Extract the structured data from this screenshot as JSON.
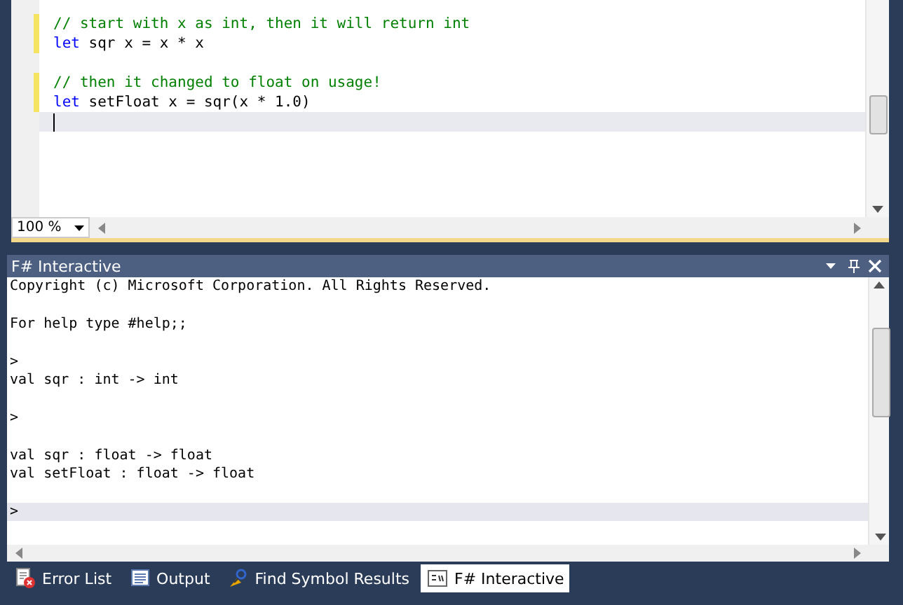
{
  "editor": {
    "lines": [
      {
        "kind": "comment",
        "text": "// start with x as int, then it will return int",
        "changed": true,
        "current": false
      },
      {
        "kind": "code",
        "keyword": "let",
        "text": " sqr x = x * x",
        "changed": true,
        "current": false
      },
      {
        "kind": "blank",
        "changed": false,
        "current": false
      },
      {
        "kind": "comment",
        "text": "// then it changed to float on usage!",
        "changed": true,
        "current": false
      },
      {
        "kind": "code",
        "keyword": "let",
        "text": " setFloat x = sqr(x * 1.0)",
        "changed": true,
        "current": false
      },
      {
        "kind": "blank",
        "changed": false,
        "current": true
      }
    ],
    "zoom": "100 %"
  },
  "interactive": {
    "title": "F# Interactive",
    "lines": [
      {
        "text": "Copyright (c) Microsoft Corporation. All Rights Reserved.",
        "current": false
      },
      {
        "current": false
      },
      {
        "text": "For help type #help;;",
        "current": false
      },
      {
        "current": false
      },
      {
        "text": ">",
        "current": false
      },
      {
        "text": "val sqr : int -> int",
        "current": false
      },
      {
        "current": false
      },
      {
        "text": ">",
        "current": false
      },
      {
        "current": false
      },
      {
        "text": "val sqr : float -> float",
        "current": false
      },
      {
        "text": "val setFloat : float -> float",
        "current": false
      },
      {
        "current": false
      },
      {
        "text": ">",
        "current": true
      }
    ]
  },
  "tabs": [
    {
      "label": "Error List",
      "selected": false
    },
    {
      "label": "Output",
      "selected": false
    },
    {
      "label": "Find Symbol Results",
      "selected": false
    },
    {
      "label": "F# Interactive",
      "selected": true
    }
  ]
}
